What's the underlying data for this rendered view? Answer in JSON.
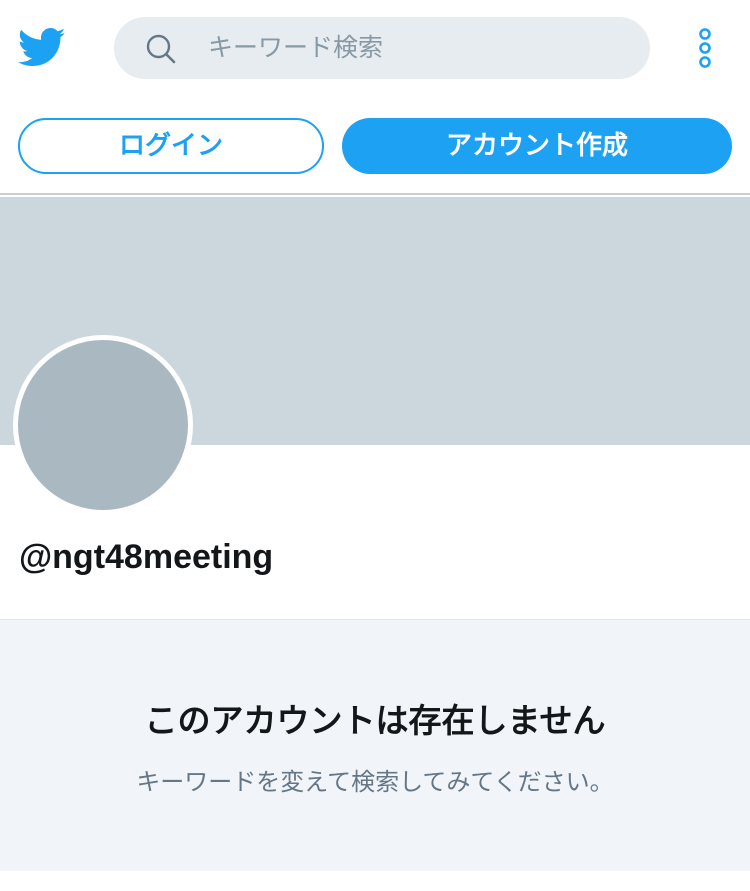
{
  "colors": {
    "brand": "#1da1f2",
    "banner": "#ccd6dd",
    "avatar": "#aab8c2",
    "search_bg": "#e6ecf0",
    "panel_bg": "#f1f5f9"
  },
  "header": {
    "logo_icon": "twitter-bird-icon",
    "search": {
      "icon": "search-icon",
      "placeholder": "キーワード検索"
    },
    "more_icon": "more-vertical-icon"
  },
  "auth": {
    "login_label": "ログイン",
    "signup_label": "アカウント作成"
  },
  "profile": {
    "handle": "@ngt48meeting"
  },
  "empty_state": {
    "title": "このアカウントは存在しません",
    "subtitle": "キーワードを変えて検索してみてください。"
  }
}
